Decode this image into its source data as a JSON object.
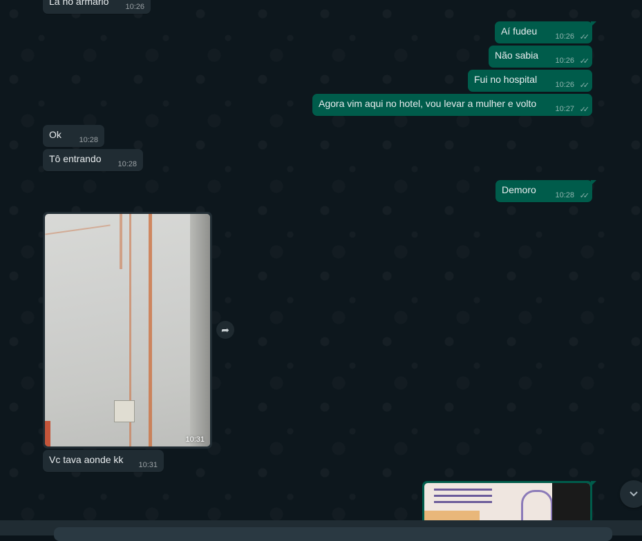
{
  "messages_incoming_top": [
    {
      "text": "Lá no armário",
      "time": "10:26"
    }
  ],
  "messages_outgoing": [
    {
      "text": "Aí fudeu",
      "time": "10:26"
    },
    {
      "text": "Não sabia",
      "time": "10:26"
    },
    {
      "text": "Fui no hospital",
      "time": "10:26"
    },
    {
      "text": "Agora vim aqui no hotel, vou levar a mulher e volto",
      "time": "10:27"
    },
    {
      "text": "Demoro",
      "time": "10:28"
    }
  ],
  "messages_incoming": [
    {
      "text": "Ok",
      "time": "10:28"
    },
    {
      "text": "Tô entrando",
      "time": "10:28"
    },
    {
      "text": "Vc tava aonde kk",
      "time": "10:31"
    }
  ],
  "media_incoming": {
    "time": "10:31"
  },
  "ticks": "✓✓",
  "icons": {
    "forward": "forward-arrow-icon",
    "scroll_down": "chevron-down-icon",
    "read_receipt": "double-check-icon"
  },
  "colors": {
    "outgoing_bubble": "#005c4b",
    "incoming_bubble": "#202c33",
    "background": "#0b141a"
  }
}
